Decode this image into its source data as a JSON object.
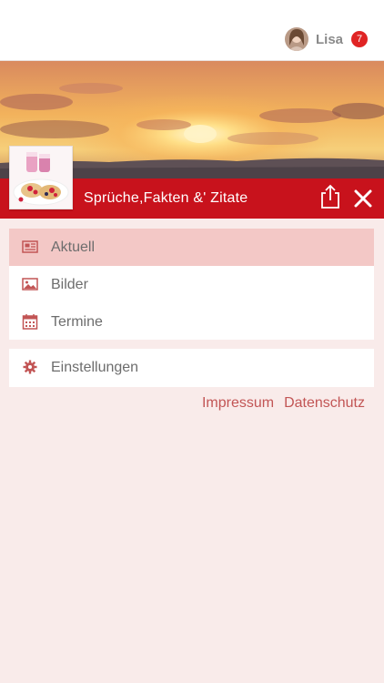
{
  "user": {
    "name": "Lisa",
    "notification_count": "7"
  },
  "header": {
    "title": "Sprüche,Fakten &' Zitate"
  },
  "menu": {
    "primary": [
      {
        "label": "Aktuell",
        "icon": "newspaper-icon",
        "active": true
      },
      {
        "label": "Bilder",
        "icon": "image-icon",
        "active": false
      },
      {
        "label": "Termine",
        "icon": "calendar-icon",
        "active": false
      }
    ],
    "secondary": [
      {
        "label": "Einstellungen",
        "icon": "gear-icon",
        "active": false
      }
    ]
  },
  "footer": {
    "impressum": "Impressum",
    "datenschutz": "Datenschutz"
  },
  "colors": {
    "brand_red": "#c8121c",
    "active_row": "#f3c8c6",
    "page_background": "#f9ebea",
    "icon_red": "#c25555",
    "badge_red": "#e02424"
  }
}
